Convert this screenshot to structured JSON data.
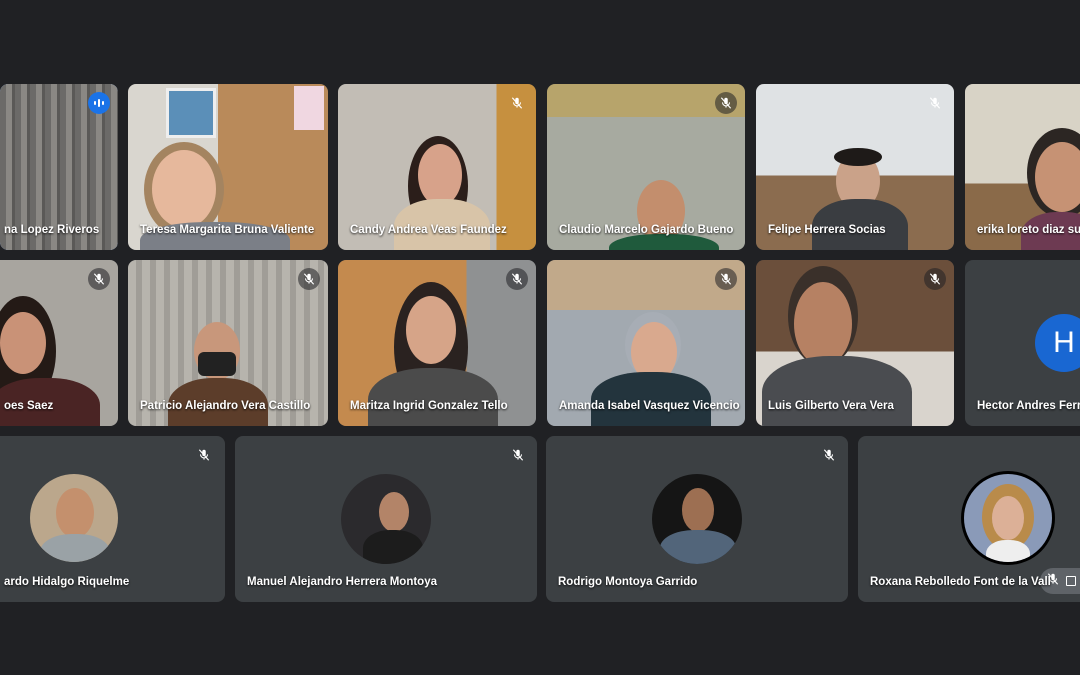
{
  "participants": [
    {
      "name": "na Lopez Riveros",
      "status": "speaking"
    },
    {
      "name": "Teresa Margarita Bruna Valiente",
      "status": "video"
    },
    {
      "name": "Candy Andrea Veas Faundez",
      "status": "muted"
    },
    {
      "name": "Claudio Marcelo Gajardo Bueno",
      "status": "muted"
    },
    {
      "name": "Felipe Herrera Socias",
      "status": "muted"
    },
    {
      "name": "erika loreto diaz sua",
      "status": "video"
    },
    {
      "name": "oes Saez",
      "status": "muted"
    },
    {
      "name": "Patricio Alejandro Vera Castillo",
      "status": "muted"
    },
    {
      "name": "Maritza Ingrid Gonzalez Tello",
      "status": "muted"
    },
    {
      "name": "Amanda Isabel Vasquez Vicencio",
      "status": "muted"
    },
    {
      "name": "Luis Gilberto Vera Vera",
      "status": "muted"
    },
    {
      "name": "Hector Andres Ferra",
      "status": "no-video",
      "initial": "H"
    },
    {
      "name": "ardo Hidalgo Riquelme",
      "status": "muted-avatar"
    },
    {
      "name": "Manuel Alejandro Herrera Montoya",
      "status": "muted-avatar"
    },
    {
      "name": "Rodrigo Montoya Garrido",
      "status": "muted-avatar"
    },
    {
      "name": "Roxana Rebolledo Font de la Vall",
      "status": "avatar-controls"
    }
  ],
  "colors": {
    "background": "#202124",
    "tile": "#3c4043",
    "accent": "#8ab4f8",
    "speaking": "#1a73e8"
  },
  "icons": {
    "mic_off": "mic-off-icon",
    "speaking": "audio-level-icon"
  }
}
